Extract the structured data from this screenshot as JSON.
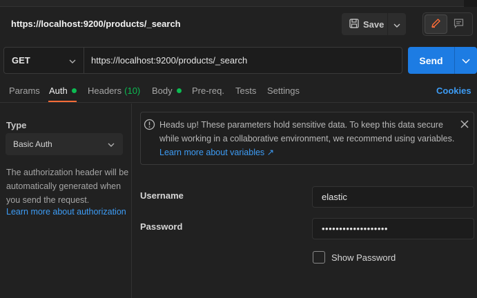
{
  "request_title": "https://localhost:9200/products/_search",
  "toolbar": {
    "save_label": "Save"
  },
  "url_bar": {
    "method": "GET",
    "url": "https://localhost:9200/products/_search",
    "send_label": "Send"
  },
  "tabs": [
    {
      "label": "Params"
    },
    {
      "label": "Auth",
      "dot": true,
      "active": true
    },
    {
      "label": "Headers",
      "count": "(10)"
    },
    {
      "label": "Body",
      "dot": true
    },
    {
      "label": "Pre-req."
    },
    {
      "label": "Tests"
    },
    {
      "label": "Settings"
    }
  ],
  "cookies_label": "Cookies",
  "auth": {
    "type_label": "Type",
    "type_value": "Basic Auth",
    "description": "The authorization header will be automatically generated when you send the request.",
    "learn_link": "Learn more about authorization"
  },
  "notice": {
    "text": "Heads up! These parameters hold sensitive data. To keep this data secure while working in a collaborative environment, we recommend using variables.",
    "link": "Learn more about variables ↗"
  },
  "fields": {
    "username_label": "Username",
    "username_value": "elastic",
    "password_label": "Password",
    "password_value": "•••••••••••••••••••",
    "show_password_label": "Show Password"
  },
  "colors": {
    "accent": "#ff6c37",
    "send": "#1d7ce3",
    "link": "#3d9cf5",
    "status_dot": "#0cbb52"
  }
}
